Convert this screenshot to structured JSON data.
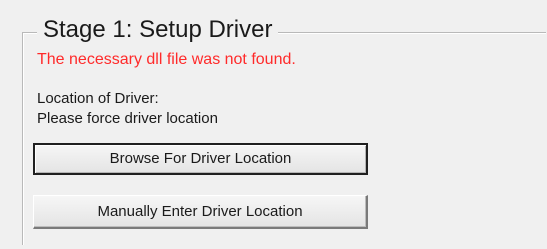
{
  "stage": {
    "title": "Stage 1: Setup Driver",
    "error_message": "The necessary dll file was not found.",
    "location_label": "Location of Driver:",
    "location_value": "Please force driver location",
    "browse_button_label": "Browse For Driver Location",
    "manual_button_label": "Manually Enter Driver Location"
  },
  "colors": {
    "error": "#ff2a2a",
    "background": "#f0f0f0"
  }
}
